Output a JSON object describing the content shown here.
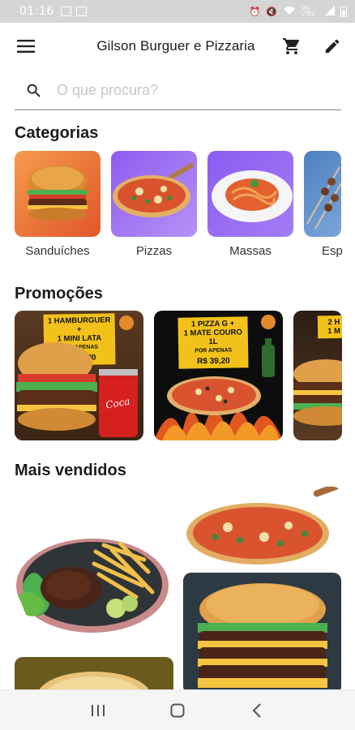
{
  "status_bar": {
    "time": "01:16",
    "network_label": "Vo) LTE1",
    "icons": [
      "image-icon",
      "notification-icon",
      "alarm-icon",
      "mute-icon",
      "wifi-icon",
      "signal-icon",
      "battery-icon"
    ]
  },
  "app_bar": {
    "menu_icon": "menu-icon",
    "title": "Gilson Burguer e Pizzaria",
    "cart_icon": "cart-icon",
    "edit_icon": "edit-icon"
  },
  "search": {
    "placeholder": "O que procura?",
    "value": "",
    "icon": "search-icon"
  },
  "categories": {
    "title": "Categorias",
    "items": [
      {
        "label": "Sanduíches",
        "image": "burger"
      },
      {
        "label": "Pizzas",
        "image": "pizza"
      },
      {
        "label": "Massas",
        "image": "pasta"
      },
      {
        "label": "Esp",
        "image": "skewers"
      }
    ]
  },
  "promotions": {
    "title": "Promoções",
    "items": [
      {
        "line1": "1 HAMBURGUER +",
        "line2": "1 MINI LATA",
        "line3": "POR APENAS",
        "price": "R$ 11,90"
      },
      {
        "line1": "1 PIZZA G +",
        "line2": "1 MATE COURO 1L",
        "line3": "POR APENAS",
        "price": "R$ 39,20"
      },
      {
        "line1": "2 H",
        "line2": "1 M",
        "line3": "",
        "price": ""
      }
    ]
  },
  "best_sellers": {
    "title": "Mais vendidos",
    "items": [
      {
        "image": "steak-fries"
      },
      {
        "image": "pizza"
      },
      {
        "image": "triple-burger"
      },
      {
        "image": "pizza-board"
      }
    ]
  },
  "nav_bar": {
    "recents_icon": "recents-icon",
    "home_icon": "home-icon",
    "back_icon": "back-icon"
  },
  "colors": {
    "accent_yellow": "#f2c21b",
    "category_purple": "#9b6ef3",
    "category_orange": "#f07a3a",
    "divider": "#8a8a8a"
  }
}
